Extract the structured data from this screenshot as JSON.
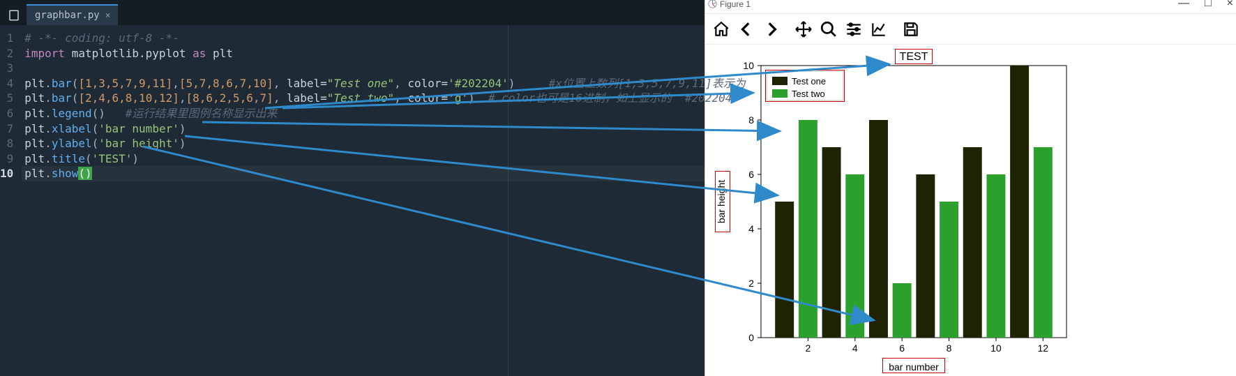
{
  "editor": {
    "tab": {
      "filename": "graphbar.py"
    },
    "lines": [
      1,
      2,
      3,
      4,
      5,
      6,
      7,
      8,
      9,
      10
    ],
    "current_line": 10,
    "code": {
      "l1_comment": "# -*- coding: utf-8 -*-",
      "l2_import": "import",
      "l2_mod": "matplotlib.pyplot",
      "l2_as": "as",
      "l2_alias": "plt",
      "l4_a": "plt",
      "l4_b": "bar",
      "l4_list1": "[1,3,5,7,9,11]",
      "l4_list2": "[5,7,8,6,7,10]",
      "l4_label_kw": "label=",
      "l4_label_v": "\"Test one\"",
      "l4_color_kw": "color=",
      "l4_color_v": "'#202204'",
      "l4_comment": "#x位置上数列[1,3,5,7,9,11]表示为",
      "l5_a": "plt",
      "l5_b": "bar",
      "l5_list1": "[2,4,6,8,10,12]",
      "l5_list2": "[8,6,2,5,6,7]",
      "l5_label_kw": "label=",
      "l5_label_v": "\"Test two\"",
      "l5_color_kw": "color=",
      "l5_color_v": "'g'",
      "l5_comment": "# color也可是16进制，如上显示的  #202204",
      "l6_a": "plt",
      "l6_b": "legend",
      "l6_comment": "#运行结果里图例名称显示出来",
      "l7_a": "plt",
      "l7_b": "xlabel",
      "l7_arg": "'bar number'",
      "l8_a": "plt",
      "l8_b": "ylabel",
      "l8_arg": "'bar height'",
      "l9_a": "plt",
      "l9_b": "title",
      "l9_arg": "'TEST'",
      "l10_a": "plt",
      "l10_b": "show"
    }
  },
  "plot_window": {
    "title": "Figure 1",
    "win_min": "—",
    "win_max": "□",
    "win_close": "×",
    "toolbar_names": [
      "home",
      "back",
      "forward",
      "move",
      "zoom",
      "configure",
      "axes",
      "save"
    ]
  },
  "chart_data": {
    "type": "bar",
    "title": "TEST",
    "xlabel": "bar number",
    "ylabel": "bar height",
    "xlim": [
      0,
      13
    ],
    "ylim": [
      0,
      10
    ],
    "xticks": [
      2,
      4,
      6,
      8,
      10,
      12
    ],
    "yticks": [
      0,
      2,
      4,
      6,
      8,
      10
    ],
    "series": [
      {
        "name": "Test one",
        "color": "#202204",
        "x": [
          1,
          3,
          5,
          7,
          9,
          11
        ],
        "values": [
          5,
          7,
          8,
          6,
          7,
          10
        ]
      },
      {
        "name": "Test two",
        "color": "#2ca02c",
        "x": [
          2,
          4,
          6,
          8,
          10,
          12
        ],
        "values": [
          8,
          6,
          2,
          5,
          6,
          7
        ]
      }
    ],
    "legend_position": "upper-left"
  }
}
